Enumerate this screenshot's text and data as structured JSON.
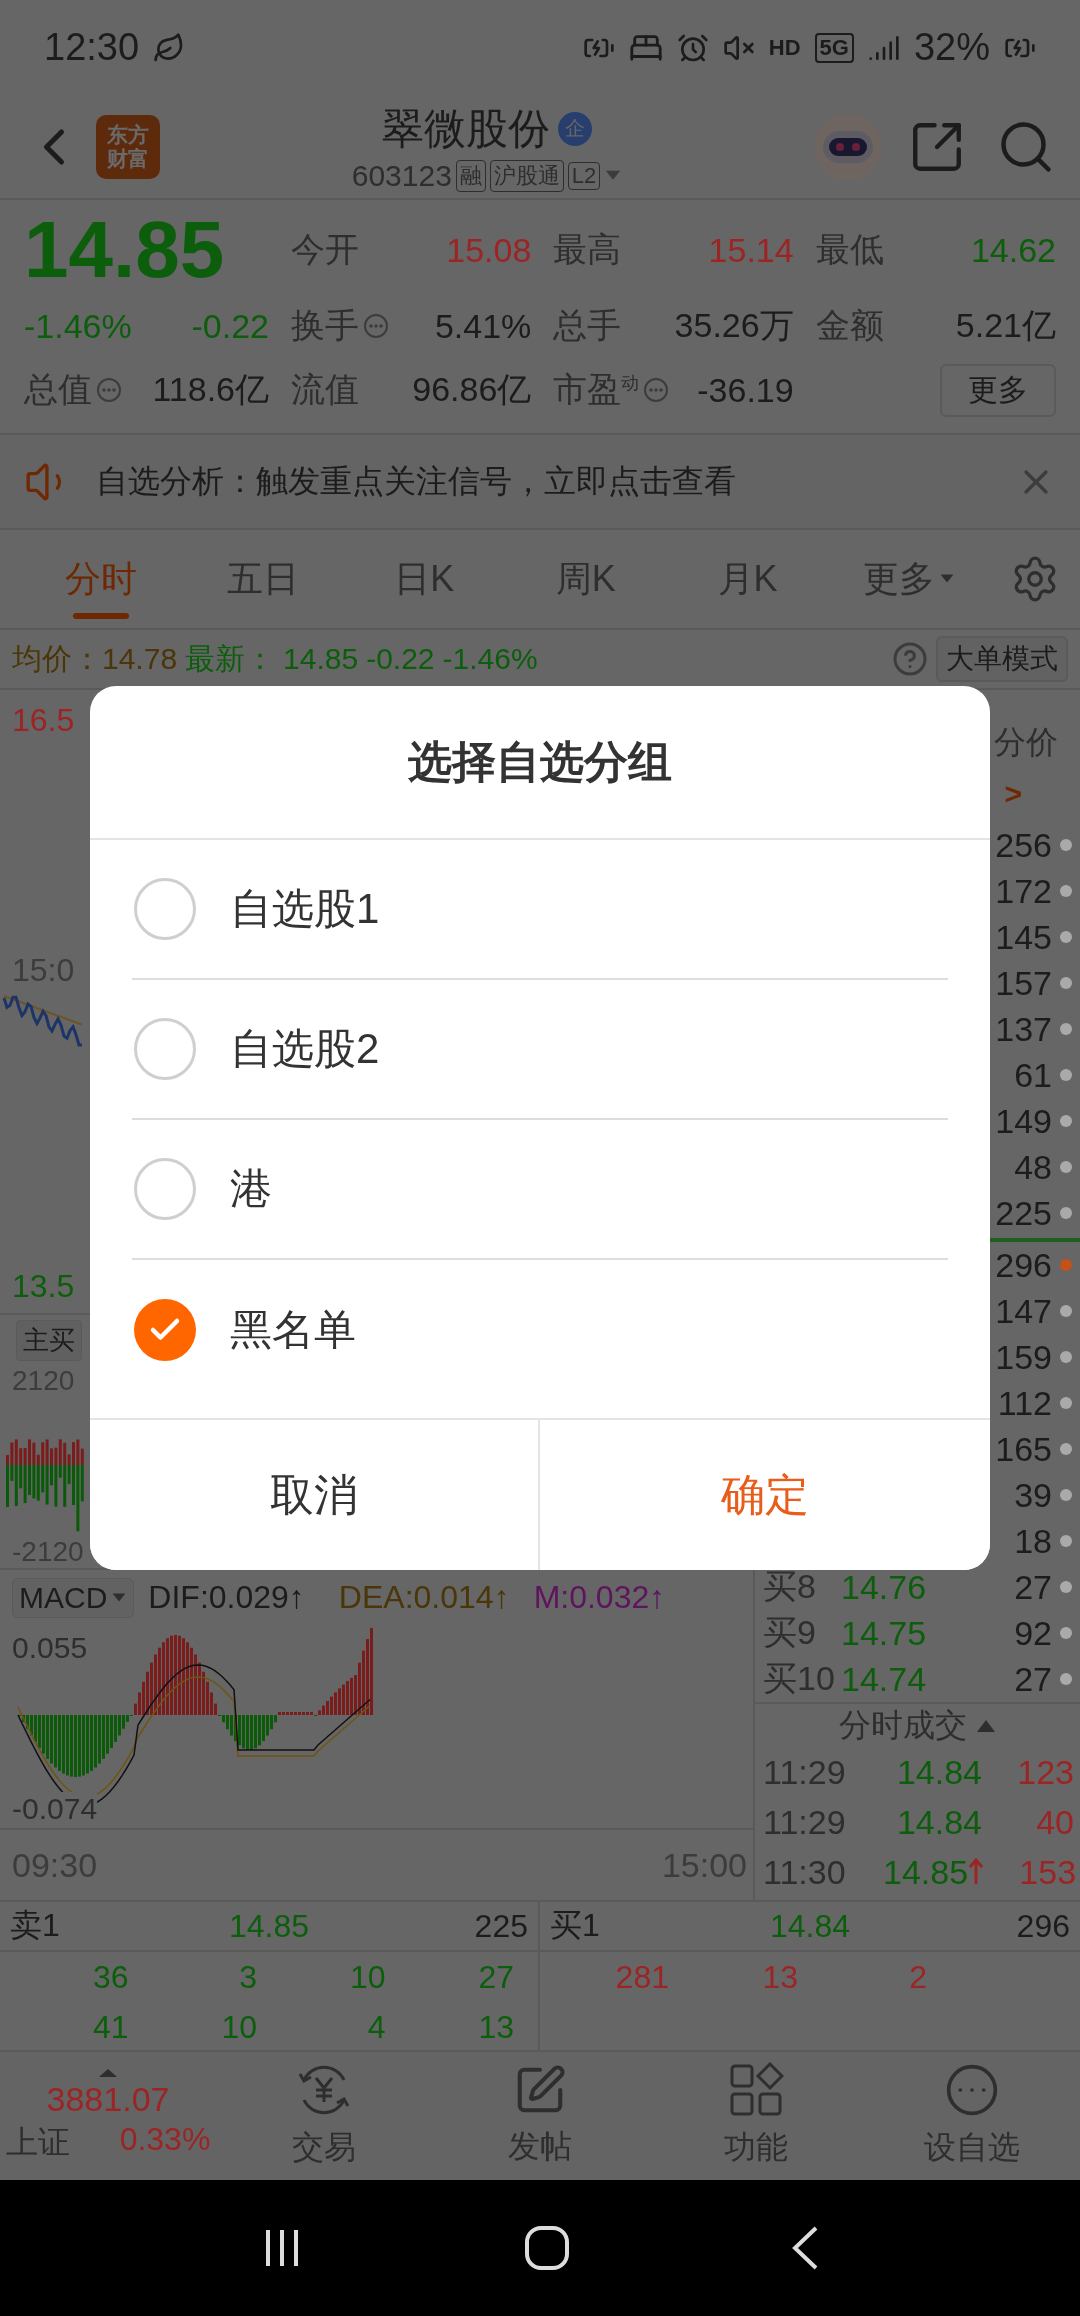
{
  "status_bar": {
    "time": "12:30",
    "hd": "HD",
    "network": "5G",
    "battery": "32%"
  },
  "header": {
    "logo": [
      "东方",
      "财富"
    ],
    "title": "翠微股份",
    "badge": "企",
    "code": "603123",
    "tags": [
      "融",
      "沪股通",
      "L2"
    ]
  },
  "quote": {
    "price": "14.85",
    "change_pct": "-1.46%",
    "change": "-0.22",
    "color": "#0c5e0c",
    "stats": [
      {
        "label": "今开",
        "value": "15.08",
        "color": "#9c2424",
        "info": false
      },
      {
        "label": "最高",
        "value": "15.14",
        "color": "#9c2424",
        "info": false
      },
      {
        "label": "最低",
        "value": "14.62",
        "color": "#0c5e0c",
        "info": false
      },
      {
        "label": "换手",
        "value": "5.41%",
        "color": "#1c1c1c",
        "info": true
      },
      {
        "label": "总手",
        "value": "35.26万",
        "color": "#1c1c1c",
        "info": false
      },
      {
        "label": "金额",
        "value": "5.21亿",
        "color": "#1c1c1c",
        "info": false
      },
      {
        "label": "总值",
        "value": "118.6亿",
        "color": "#1c1c1c",
        "info": true
      },
      {
        "label": "流值",
        "value": "96.86亿",
        "color": "#1c1c1c",
        "info": false
      },
      {
        "label": "市盈$^{动}$",
        "value": "-36.19",
        "color": "#1c1c1c",
        "info": true
      }
    ],
    "more_button": "更多"
  },
  "notice": {
    "text": "自选分析：触发重点关注信号，立即点击查看"
  },
  "tabs": [
    {
      "label": "分时",
      "selected": true,
      "kind": "plain"
    },
    {
      "label": "五日",
      "selected": false,
      "kind": "plain"
    },
    {
      "label": "日K",
      "selected": false,
      "kind": "plain"
    },
    {
      "label": "周K",
      "selected": false,
      "kind": "plain"
    },
    {
      "label": "月K",
      "selected": false,
      "kind": "plain"
    },
    {
      "label": "更多",
      "selected": false,
      "kind": "dropdown"
    }
  ],
  "price_line": {
    "avg_label": "均价：",
    "avg": "14.78",
    "latest_label": "最新：",
    "latest": "14.85",
    "change": "-0.22",
    "change_pct": "-1.46%",
    "mode_button": "大单模式"
  },
  "chart": {
    "high": "16.5",
    "mid": "15:0",
    "low": "13.5",
    "flow_tag": "主买",
    "flow_high": "2120",
    "flow_low": "-2120",
    "indicator": "MACD",
    "dif": "DIF:0.029↑",
    "dea": "DEA:0.014↑",
    "m": "M:0.032↑",
    "macd_high": "0.055",
    "macd_low": "-0.074",
    "time_start": "09:30",
    "time_end": "15:00"
  },
  "order_column": {
    "header": "分价",
    "link": ">",
    "asks": [
      {
        "quantity": "256",
        "color": "#aaaaaa"
      },
      {
        "quantity": "172",
        "color": "#aaaaaa"
      },
      {
        "quantity": "145",
        "color": "#aaaaaa"
      },
      {
        "quantity": "157",
        "color": "#aaaaaa"
      },
      {
        "quantity": "137",
        "color": "#aaaaaa"
      },
      {
        "quantity": "61",
        "color": "#aaaaaa"
      },
      {
        "quantity": "149",
        "color": "#aaaaaa"
      },
      {
        "quantity": "48",
        "color": "#aaaaaa"
      },
      {
        "quantity": "225",
        "color": "#aaaaaa"
      }
    ],
    "bids": [
      {
        "quantity": "296",
        "color": "#c4501a"
      },
      {
        "quantity": "147",
        "color": "#aaaaaa"
      },
      {
        "quantity": "159",
        "color": "#aaaaaa"
      },
      {
        "quantity": "112",
        "color": "#aaaaaa"
      },
      {
        "quantity": "165",
        "color": "#aaaaaa"
      },
      {
        "quantity": "39",
        "color": "#aaaaaa"
      },
      {
        "quantity": "18",
        "color": "#aaaaaa"
      },
      {
        "label": "买8",
        "price": "14.76",
        "quantity": "27",
        "color": "#aaaaaa"
      },
      {
        "label": "买9",
        "price": "14.75",
        "quantity": "92",
        "color": "#aaaaaa"
      },
      {
        "label": "买10",
        "price": "14.74",
        "quantity": "27",
        "color": "#aaaaaa"
      }
    ]
  },
  "trades": {
    "header": "分时成交",
    "rows": [
      {
        "time": "11:29",
        "price": "14.84",
        "volume": "123",
        "up_tick": false
      },
      {
        "time": "11:29",
        "price": "14.84",
        "volume": "40",
        "up_tick": false
      },
      {
        "time": "11:30",
        "price": "14.85",
        "volume": "153",
        "up_tick": true
      }
    ]
  },
  "depth": {
    "ask": {
      "label": "卖1",
      "price": "14.85",
      "quantity": "225"
    },
    "bid": {
      "label": "买1",
      "price": "14.84",
      "quantity": "296"
    },
    "ask_orders": [
      [
        "36",
        "3",
        "10",
        "27"
      ],
      [
        "41",
        "10",
        "4",
        "13"
      ]
    ],
    "bid_orders": [
      [
        "281",
        "13",
        "2"
      ]
    ]
  },
  "bottom_nav": {
    "index": {
      "value": "3881.07",
      "name": "上证",
      "change": "0.33%"
    },
    "items": [
      {
        "label": "交易",
        "kind": "trade"
      },
      {
        "label": "发帖",
        "kind": "post"
      },
      {
        "label": "功能",
        "kind": "apps"
      },
      {
        "label": "设自选",
        "kind": "more"
      }
    ]
  },
  "dialog": {
    "title": "选择自选分组",
    "options": [
      {
        "label": "自选股1",
        "selected": false
      },
      {
        "label": "自选股2",
        "selected": false
      },
      {
        "label": "港",
        "selected": false
      },
      {
        "label": "黑名单",
        "selected": true
      }
    ],
    "cancel": "取消",
    "confirm": "确定"
  }
}
